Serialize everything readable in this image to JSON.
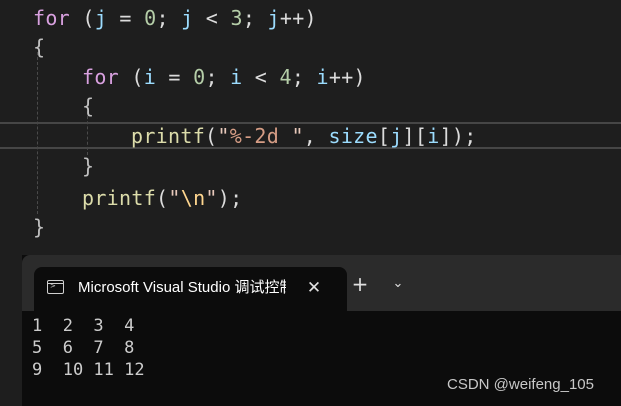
{
  "editor": {
    "line1": {
      "kw": "for",
      "open": " (",
      "v1": "j",
      "eq": " = ",
      "n1": "0",
      "semi1": "; ",
      "v2": "j",
      "lt": " < ",
      "n2": "3",
      "semi2": "; ",
      "v3": "j",
      "inc": "++)"
    },
    "line2": {
      "brace": "{"
    },
    "line3": {
      "kw": "for",
      "open": " (",
      "v1": "i",
      "eq": " = ",
      "n1": "0",
      "semi1": "; ",
      "v2": "i",
      "lt": " < ",
      "n2": "4",
      "semi2": "; ",
      "v3": "i",
      "inc": "++)"
    },
    "line4": {
      "brace": "{"
    },
    "line5": {
      "fn": "printf",
      "open": "(",
      "q1": "\"",
      "fmt": "%-2d",
      "q2": " \"",
      "comma": ", ",
      "arr": "size",
      "b1": "[",
      "idx1": "j",
      "b2": "][",
      "idx2": "i",
      "close": "]);"
    },
    "line6": {
      "brace": "}"
    },
    "line7": {
      "fn": "printf",
      "open": "(",
      "q1": "\"",
      "esc": "\\n",
      "q2": "\"",
      "close": ");"
    },
    "line8": {
      "brace": "}"
    }
  },
  "terminal": {
    "tab_icon": "terminal-icon",
    "tab_title": "Microsoft Visual Studio 调试控制台",
    "close_symbol": "✕",
    "new_tab_symbol": "+",
    "dropdown_symbol": "⌄",
    "output": [
      "1  2  3  4",
      "5  6  7  8",
      "9  10 11 12"
    ]
  },
  "watermark": "CSDN @weifeng_105"
}
